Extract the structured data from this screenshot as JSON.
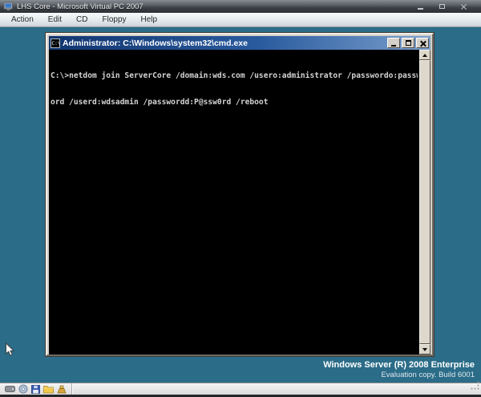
{
  "window": {
    "title": "LHS Core - Microsoft Virtual PC 2007"
  },
  "menu": {
    "items": [
      {
        "label": "Action"
      },
      {
        "label": "Edit"
      },
      {
        "label": "CD"
      },
      {
        "label": "Floppy"
      },
      {
        "label": "Help"
      }
    ]
  },
  "vm": {
    "console": {
      "title": "Administrator: C:\\Windows\\system32\\cmd.exe",
      "lines": [
        "C:\\>netdom join ServerCore /domain:wds.com /usero:administrator /passwordo:passw",
        "ord /userd:wdsadmin /passwordd:P@ssw0rd /reboot"
      ]
    },
    "watermark": {
      "line1": "Windows Server (R) 2008 Enterprise",
      "line2": "Evaluation copy. Build 6001"
    }
  },
  "statusbar": {
    "icons": [
      "hard-disk-icon",
      "cd-drive-icon",
      "floppy-drive-icon",
      "shared-folder-icon",
      "network-adapter-icon"
    ]
  },
  "colors": {
    "desktop_teal": "#2b6c88",
    "console_titlebar_left": "#10356f",
    "console_titlebar_right": "#7a9fcd",
    "console_background": "#000000",
    "console_text": "#d4d4d4",
    "classic_chrome": "#d4d0c8"
  }
}
